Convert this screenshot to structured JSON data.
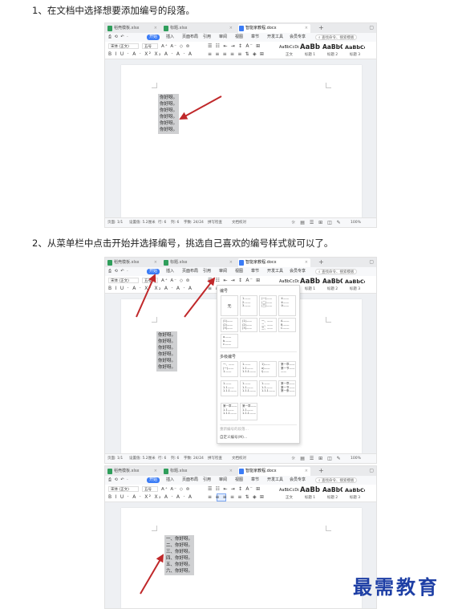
{
  "steps": [
    {
      "text": "1、在文档中选择想要添加编号的段落。"
    },
    {
      "text": "2、从菜单栏中点击开始并选择编号，挑选自己喜欢的编号样式就可以了。"
    }
  ],
  "shots": [
    {
      "tabs": [
        "稻壳模板.xlsx",
        "标题.xlsx",
        "智能家教程.docx"
      ],
      "menu": [
        "开始",
        "插入",
        "页面布局",
        "引用",
        "审阅",
        "视图",
        "章节",
        "开发工具",
        "会员专享"
      ],
      "search": "查找命令、搜索模板",
      "font": "宋体 (正文)",
      "size": "五号",
      "styles": [
        {
          "preview": "AaBbCcDd",
          "name": "正文"
        },
        {
          "preview": "AaBb",
          "name": "标题 1"
        },
        {
          "preview": "AaBbC",
          "name": "标题 2"
        },
        {
          "preview": "AaBbCc",
          "name": "标题 3"
        }
      ],
      "lines": [
        "你好呀。",
        "你好呀。",
        "你好呀。",
        "你好呀。",
        "你好呀。",
        "你好呀。"
      ],
      "status": {
        "page": "页面: 1/1",
        "settings": "设置值: 5.2厘米",
        "row": "行: 6",
        "col": "列: 6",
        "words": "字数: 24/24",
        "spell": "拼写检查",
        "proof": "文档校对",
        "zoom": "100%"
      }
    },
    {
      "tabs": [
        "稻壳模板.xlsx",
        "标题.xlsx",
        "智能家教程.docx"
      ],
      "menu": [
        "开始",
        "插入",
        "页面布局",
        "引用",
        "审阅",
        "视图",
        "章节",
        "开发工具",
        "会员专享"
      ],
      "search": "查找命令、搜索模板",
      "font": "宋体 (正文)",
      "size": "五号",
      "styles": [
        {
          "preview": "AaBbCcDd",
          "name": "正文"
        },
        {
          "preview": "AaBb",
          "name": "标题 1"
        },
        {
          "preview": "AaBbC",
          "name": "标题 2"
        },
        {
          "preview": "AaBbCc",
          "name": "标题 3"
        }
      ],
      "lines": [
        "你好呀。",
        "你好呀。",
        "你好呀。",
        "你好呀。",
        "你好呀。",
        "你好呀。"
      ],
      "status": {
        "page": "页面: 1/1",
        "settings": "设置值: 5.2厘米",
        "row": "行: 6",
        "col": "列: 6",
        "words": "字数: 24/24",
        "spell": "拼写检查",
        "proof": "文档校对",
        "zoom": "100%"
      },
      "numbering_popup": {
        "header": "编号",
        "none_label": "无",
        "grid_row1": [
          "1.——\n2.——\n3.——",
          "(一)——\n(二)——\n(三)——",
          "①——\n②——\n③——"
        ],
        "grid_row2": [
          "(1)——\n(2)——\n(3)——",
          "(1)——\n(2)——\n(3)——",
          "一、——\n二、——\n三、——",
          "A.——\nB.——\nC.——"
        ],
        "grid_row3": [
          "a.——\nb.——\nc.——"
        ],
        "multi_header": "多级编号",
        "multi_row1": [
          "一、——\n(一)——\n1.——",
          "1.——\n1.1.——\n1.1.1.——",
          "1)——\na)——\ni)——",
          "第一章——\n第一节——\n——"
        ],
        "multi_row2": [
          "1.——\n1.1.——\n1.1.1.——",
          "1.——\n1.1.——\n1.1.1.——",
          "1.——\n1.1.——\n1.1.1.——",
          "第一章——\n第一节——\n第一条——"
        ],
        "multi_row3": [
          "第一章——\n1.1.——\n1.1.1.——",
          "第一章——\n1.1.——\n1.1.1.——"
        ],
        "menu_custom_dim": "重新编号的段落…",
        "menu_custom": "自定义编号(M)..."
      }
    },
    {
      "tabs": [
        "稻壳模板.xlsx",
        "标题.xlsx",
        "智能家教程.docx"
      ],
      "menu": [
        "开始",
        "插入",
        "页面布局",
        "引用",
        "审阅",
        "视图",
        "章节",
        "开发工具",
        "会员专享"
      ],
      "search": "查找命令、搜索模板",
      "font": "宋体 (正文)",
      "size": "五号",
      "styles": [
        {
          "preview": "AaBbCcDd",
          "name": "正文"
        },
        {
          "preview": "AaBb",
          "name": "标题 1"
        },
        {
          "preview": "AaBbC",
          "name": "标题 2"
        },
        {
          "preview": "AaBbCc",
          "name": "标题 3"
        }
      ],
      "lines": [
        "一、你好呀。",
        "二、你好呀。",
        "三、你好呀。",
        "四、你好呀。",
        "五、你好呀。",
        "六、你好呀。"
      ]
    }
  ],
  "watermark": "最需教育",
  "colors": {
    "accent": "#3b7cf6",
    "arrow": "#c0282a",
    "selection": "#cfd0d2",
    "watermark": "#1e3fa5"
  }
}
